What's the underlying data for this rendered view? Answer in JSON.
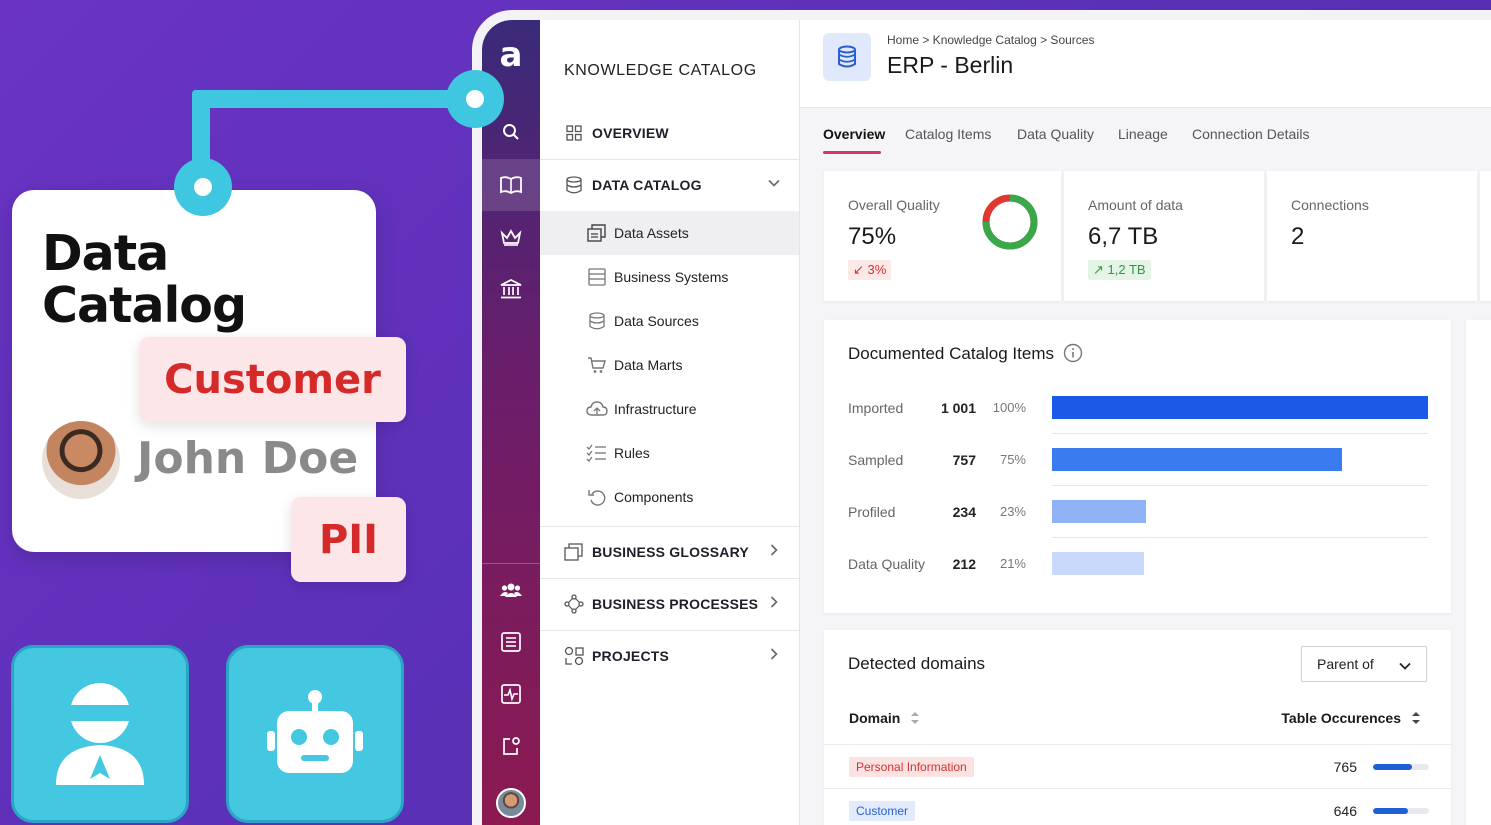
{
  "marketing": {
    "card_title": [
      "Data",
      "Catalog"
    ],
    "tag_customer": "Customer",
    "person_name": "John Doe",
    "tag_pii": "PII"
  },
  "app": {
    "logo": "a",
    "rail_icons": [
      "search-icon",
      "book-icon",
      "crown-icon",
      "bank-icon",
      "users-icon",
      "list-icon",
      "activity-icon",
      "share-icon"
    ],
    "nav": {
      "title": "KNOWLEDGE CATALOG",
      "overview": "OVERVIEW",
      "data_catalog": "DATA CATALOG",
      "sub": [
        "Data Assets",
        "Business Systems",
        "Data Sources",
        "Data Marts",
        "Infrastructure",
        "Rules",
        "Components"
      ],
      "business_glossary": "BUSINESS GLOSSARY",
      "business_processes": "BUSINESS PROCESSES",
      "projects": "PROJECTS"
    },
    "header": {
      "breadcrumb": "Home > Knowledge Catalog > Sources",
      "title": "ERP - Berlin"
    },
    "tabs": [
      "Overview",
      "Catalog Items",
      "Data Quality",
      "Lineage",
      "Connection Details"
    ],
    "kpis": {
      "quality": {
        "label": "Overall Quality",
        "value": "75%",
        "delta": "3%",
        "donut_fraction": 0.75,
        "colors": {
          "good": "#3aa84a",
          "bad": "#e0372f"
        }
      },
      "amount": {
        "label": "Amount of data",
        "value": "6,7 TB",
        "delta": "1,2 TB"
      },
      "connections": {
        "label": "Connections",
        "value": "2"
      }
    },
    "documented": {
      "title": "Documented Catalog Items",
      "rows": [
        {
          "label": "Imported",
          "count": "1 001",
          "pct": "100%",
          "fraction": 1.0,
          "color": "#1a5ae6"
        },
        {
          "label": "Sampled",
          "count": "757",
          "pct": "75%",
          "fraction": 0.77,
          "color": "#3b7bf0"
        },
        {
          "label": "Profiled",
          "count": "234",
          "pct": "23%",
          "fraction": 0.25,
          "color": "#8fb1f6"
        },
        {
          "label": "Data Quality",
          "count": "212",
          "pct": "21%",
          "fraction": 0.245,
          "color": "#c7d8fb"
        }
      ]
    },
    "domains": {
      "title": "Detected domains",
      "select": "Parent of",
      "col_domain": "Domain",
      "col_occ": "Table Occurences",
      "rows": [
        {
          "chip": "Personal Information",
          "chip_bg": "#fde2e2",
          "chip_fg": "#d63030",
          "value": "765",
          "fraction": 0.7
        },
        {
          "chip": "Customer",
          "chip_bg": "#e1ebfc",
          "chip_fg": "#2a5fcf",
          "value": "646",
          "fraction": 0.62
        }
      ]
    }
  }
}
